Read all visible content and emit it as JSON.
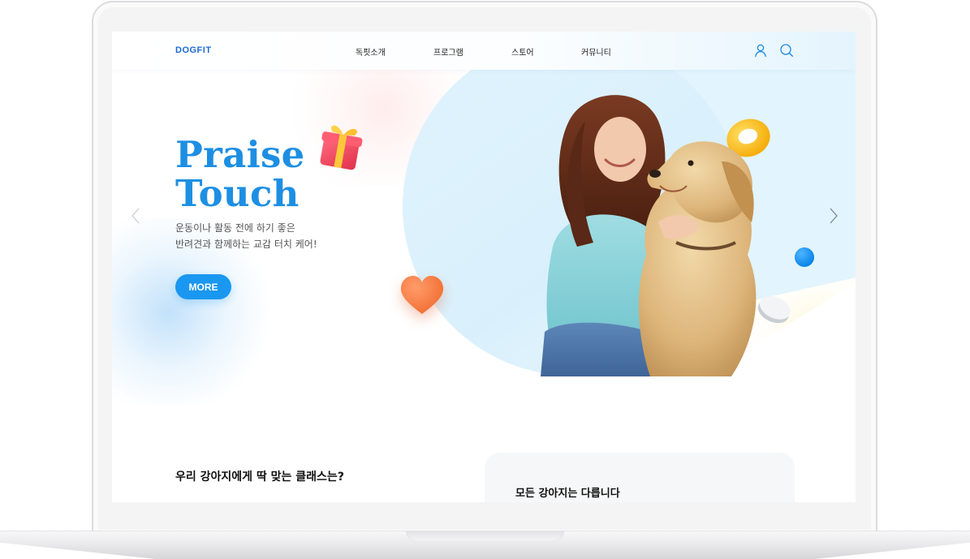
{
  "header": {
    "logo": "DOGFIT",
    "nav": [
      "독핏소개",
      "프로그램",
      "스토어",
      "커뮤니티"
    ],
    "icons": [
      "user-icon",
      "search-icon"
    ]
  },
  "hero": {
    "title_line1": "Praise",
    "title_line2": "Touch",
    "subtitle_line1": "운동이나 활동 전에 하기 좋은",
    "subtitle_line2": "반려견과 함께하는 교감 터치 케어!",
    "cta_label": "MORE",
    "icons": [
      "chevron-left-icon",
      "chevron-right-icon",
      "gift-icon",
      "heart-icon",
      "ring-toy-icon",
      "pill-icon"
    ]
  },
  "section": {
    "class_title": "우리 강아지에게 딱 맞는 클래스는?",
    "card_title": "모든 강아지는 다릅니다"
  },
  "colors": {
    "accent": "#1a97f0",
    "title_blue": "#1d8fe3",
    "logo_blue": "#1e6bd0",
    "hero_bg": "#e0f3fd"
  }
}
